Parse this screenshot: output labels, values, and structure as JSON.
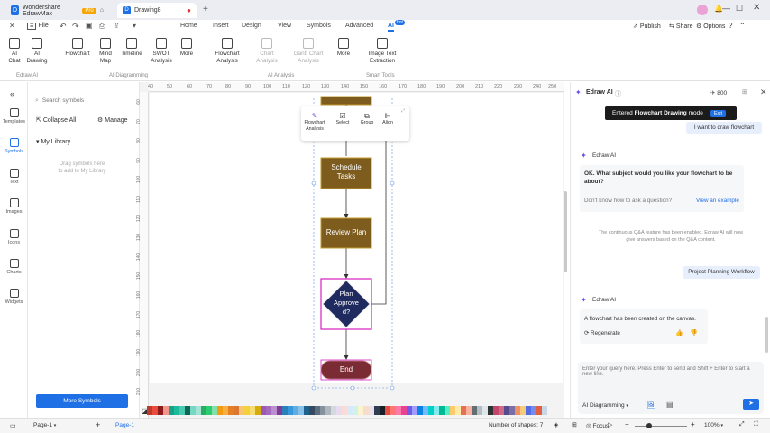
{
  "titlebar": {
    "app_tab": "Wondershare EdrawMax",
    "pro_badge": "Pro",
    "doc_tab": "Drawing8",
    "new_tab": "+"
  },
  "menubar": {
    "file": "File",
    "tabs": [
      "Home",
      "Insert",
      "Design",
      "View",
      "Symbols",
      "Advanced",
      "AI"
    ],
    "ai_badge": "hot",
    "right": {
      "publish": "Publish",
      "share": "Share",
      "options": "Options"
    }
  },
  "ribbon": {
    "buttons": [
      {
        "label": "AI\nChat"
      },
      {
        "label": "AI\nDrawing"
      },
      {
        "label": "Flowchart"
      },
      {
        "label": "Mind\nMap"
      },
      {
        "label": "Timeline"
      },
      {
        "label": "SWOT\nAnalysis"
      },
      {
        "label": "More"
      },
      {
        "label": "Flowchart\nAnalysis"
      },
      {
        "label": "Chart\nAnalysis"
      },
      {
        "label": "Gantt Chart\nAnalysis"
      },
      {
        "label": "More"
      },
      {
        "label": "Image Text\nExtraction"
      }
    ],
    "groups": [
      "Edraw AI",
      "AI Diagramming",
      "AI Analysis",
      "Smart Tools"
    ]
  },
  "rail": [
    {
      "label": "Templates"
    },
    {
      "label": "Symbols"
    },
    {
      "label": "Text"
    },
    {
      "label": "Images"
    },
    {
      "label": "Icons"
    },
    {
      "label": "Charts"
    },
    {
      "label": "Widgets"
    }
  ],
  "panel": {
    "search_placeholder": "Search symbols",
    "collapse_all": "Collapse All",
    "manage": "Manage",
    "my_library": "My Library",
    "drag_hint": "Drag symbols here\nto add to My Library",
    "more_symbols": "More Symbols"
  },
  "ruler": {
    "h": [
      "40",
      "50",
      "60",
      "70",
      "80",
      "90",
      "100",
      "110",
      "120",
      "130",
      "140",
      "150",
      "160",
      "170",
      "180",
      "190",
      "200",
      "210",
      "220",
      "230",
      "240",
      "250"
    ],
    "v": [
      "60",
      "70",
      "80",
      "90",
      "100",
      "110",
      "120",
      "130",
      "140",
      "150",
      "160",
      "170",
      "180",
      "190",
      "200",
      "210"
    ]
  },
  "canvas": {
    "shapes": {
      "schedule": "Schedule\nTasks",
      "review": "Review Plan",
      "decision": "Plan\nApprove\nd?",
      "end": "End"
    },
    "popup": [
      {
        "label": "Flowchart\nAnalysis"
      },
      {
        "label": "Select"
      },
      {
        "label": "Group"
      },
      {
        "label": "Align"
      }
    ],
    "colors": {
      "process": "#7d5c1e",
      "decision": "#1f2a5e",
      "end": "#7a2b33",
      "selection": "#d61fbe"
    }
  },
  "aipanel": {
    "title": "Edraw AI",
    "credits": "800",
    "mode_banner_prefix": "Entered",
    "mode_banner_bold": "Flowchart Drawing",
    "mode_banner_suffix": "mode",
    "exit": "Exit",
    "msg_user1": "I want to draw flowchart",
    "bot_name": "Edraw AI",
    "bot_q": "OK. What subject would you like your flowchart to be about?",
    "dont_know": "Don't know how to ask a question?",
    "view_example": "View an example",
    "info": "The continuous Q&A feature has been enabled. Edraw AI will now give answers based on the Q&A content.",
    "msg_user2": "Project Planning Workflow",
    "bot_done": "A flowchart has been created on the canvas.",
    "regenerate": "Regenerate",
    "input_placeholder": "Enter your query here. Press Enter to send and Shift + Enter to start a new line.",
    "mode_select": "AI Diagramming"
  },
  "status": {
    "page_select": "Page-1",
    "page_tab": "Page-1",
    "shapes_count": "Number of shapes: 7",
    "focus": "Focus",
    "zoom": "100%"
  },
  "palette": [
    "#c0392b",
    "#e74c3c",
    "#8e1b1b",
    "#f1948a",
    "#16a085",
    "#1abc9c",
    "#48c9b0",
    "#0e6655",
    "#76d7c4",
    "#a3e4d7",
    "#27ae60",
    "#2ecc71",
    "#82e0aa",
    "#f39c12",
    "#f5b041",
    "#e67e22",
    "#dc7633",
    "#f8c471",
    "#f4d03f",
    "#f7dc6f",
    "#d4ac0d",
    "#9b59b6",
    "#a569bd",
    "#bb8fce",
    "#7d3c98",
    "#2980b9",
    "#3498db",
    "#5dade2",
    "#85c1e9",
    "#1f618d",
    "#34495e",
    "#5d6d7e",
    "#85929e",
    "#aeb6bf",
    "#d5d8dc",
    "#e8daef",
    "#fadbd8",
    "#d6eaf8",
    "#d1f2eb",
    "#fcf3cf",
    "#f6ddcc",
    "#ebdef0",
    "#2c3e50",
    "#17202a",
    "#e74c3c",
    "#ff7675",
    "#fd79a8",
    "#e84393",
    "#6c5ce7",
    "#a29bfe",
    "#0984e3",
    "#74b9ff",
    "#00cec9",
    "#81ecec",
    "#00b894",
    "#55efc4",
    "#fdcb6e",
    "#ffeaa7",
    "#e17055",
    "#fab1a0",
    "#636e72",
    "#b2bec3",
    "#dfe6e9",
    "#2d3436",
    "#c44569",
    "#cf6a87",
    "#574b90",
    "#786fa6",
    "#f19066",
    "#f5cd79",
    "#546de5",
    "#778beb",
    "#e15f41",
    "#c8d6e5"
  ]
}
